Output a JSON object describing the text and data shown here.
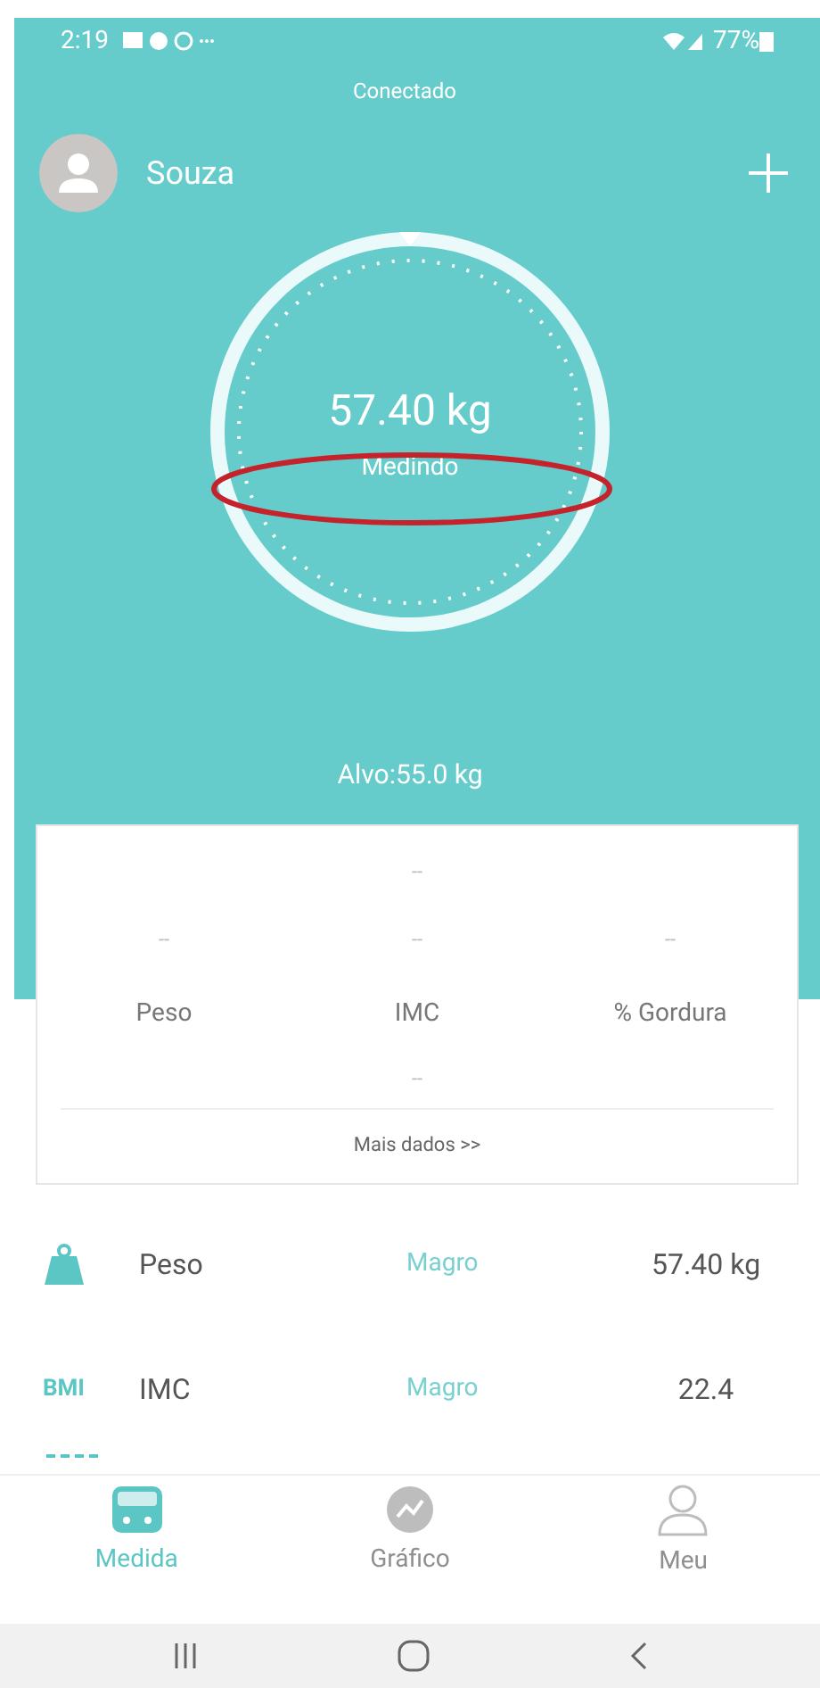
{
  "status_bar": {
    "time": "2:19",
    "battery": "77%"
  },
  "header": {
    "connection": "Conectado",
    "user": "Souza"
  },
  "gauge": {
    "weight": "57.40 kg",
    "state": "Medindo",
    "target": "Alvo:55.0 kg"
  },
  "summary": {
    "top_value": "--",
    "metrics": [
      {
        "value": "--",
        "label": "Peso"
      },
      {
        "value": "--",
        "label": "IMC"
      },
      {
        "value": "--",
        "label": "% Gordura"
      }
    ],
    "bottom_value": "--",
    "more": "Mais dados >>"
  },
  "rows": [
    {
      "kind": "weight",
      "name": "Peso",
      "status": "Magro",
      "value": "57.40 kg"
    },
    {
      "kind": "badge",
      "badge": "BMI",
      "name": "IMC",
      "status": "Magro",
      "value": "22.4"
    }
  ],
  "tabs": [
    {
      "label": "Medida",
      "selected": true
    },
    {
      "label": "Gráfico",
      "selected": false
    },
    {
      "label": "Meu",
      "selected": false
    }
  ]
}
